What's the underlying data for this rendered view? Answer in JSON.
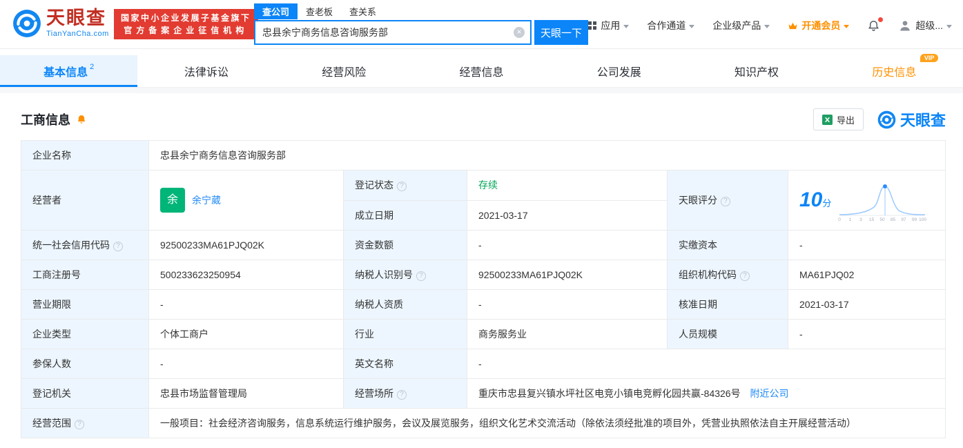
{
  "icons": {
    "help": "?",
    "clear": "×",
    "vip": "VIP"
  },
  "colors": {
    "accent_blue": "#0b85f8",
    "brand_red": "#c22e22",
    "badge_red": "#e23b31",
    "vip_orange": "#ff9000",
    "status_green": "#00a758",
    "avatar_green": "#00b578",
    "label_cell_bg": "#edf6fe"
  },
  "header": {
    "logo_text": "天眼查",
    "logo_sub": "TianYanCha.com",
    "badge_line1": "国家中小企业发展子基金旗下",
    "badge_line2": "官方备案企业征信机构",
    "search_tabs": [
      {
        "label": "查公司"
      },
      {
        "label": "查老板"
      },
      {
        "label": "查关系"
      }
    ],
    "search_value": "忠县余宁商务信息咨询服务部",
    "search_button": "天眼一下",
    "nav": [
      "应用",
      "合作通道",
      "企业级产品",
      "开通会员",
      "超级..."
    ]
  },
  "tabs": [
    {
      "label": "基本信息",
      "badge": "2"
    },
    {
      "label": "法律诉讼"
    },
    {
      "label": "经营风险"
    },
    {
      "label": "经营信息"
    },
    {
      "label": "公司发展"
    },
    {
      "label": "知识产权"
    },
    {
      "label": "历史信息",
      "tag": "VIP"
    }
  ],
  "section": {
    "title": "工商信息",
    "export_label": "导出",
    "watermark": "天眼查"
  },
  "fields": {
    "company_name_label": "企业名称",
    "company_name": "忠县余宁商务信息咨询服务部",
    "operator_label": "经营者",
    "operator_avatar": "余",
    "operator_name": "余宁葳",
    "reg_status_label": "登记状态",
    "reg_status": "存续",
    "est_date_label": "成立日期",
    "est_date": "2021-03-17",
    "score_label": "天眼评分",
    "score_value": "10",
    "score_unit": "分",
    "score_axis": [
      "0",
      "1",
      "3",
      "15",
      "50",
      "85",
      "97",
      "99",
      "100"
    ],
    "credit_code_label": "统一社会信用代码",
    "credit_code": "92500233MA61PJQ02K",
    "capital_label": "资金数额",
    "capital": "-",
    "paid_capital_label": "实缴资本",
    "paid_capital": "-",
    "reg_no_label": "工商注册号",
    "reg_no": "500233623250954",
    "taxpayer_id_label": "纳税人识别号",
    "taxpayer_id": "92500233MA61PJQ02K",
    "org_code_label": "组织机构代码",
    "org_code": "MA61PJQ02",
    "term_label": "营业期限",
    "term": "-",
    "taxpayer_qual_label": "纳税人资质",
    "taxpayer_qual": "-",
    "approve_date_label": "核准日期",
    "approve_date": "2021-03-17",
    "company_type_label": "企业类型",
    "company_type": "个体工商户",
    "industry_label": "行业",
    "industry": "商务服务业",
    "staff_label": "人员规模",
    "staff": "-",
    "insured_label": "参保人数",
    "insured": "-",
    "en_name_label": "英文名称",
    "en_name": "-",
    "authority_label": "登记机关",
    "authority": "忠县市场监督管理局",
    "address_label": "经营场所",
    "address": "重庆市忠县复兴镇水坪社区电竞小镇电竞孵化园共赢-84326号",
    "nearby_link": "附近公司",
    "scope_label": "经营范围",
    "scope": "一般项目：社会经济咨询服务，信息系统运行维护服务，会议及展览服务，组织文化艺术交流活动（除依法须经批准的项目外，凭营业执照依法自主开展经营活动）"
  }
}
